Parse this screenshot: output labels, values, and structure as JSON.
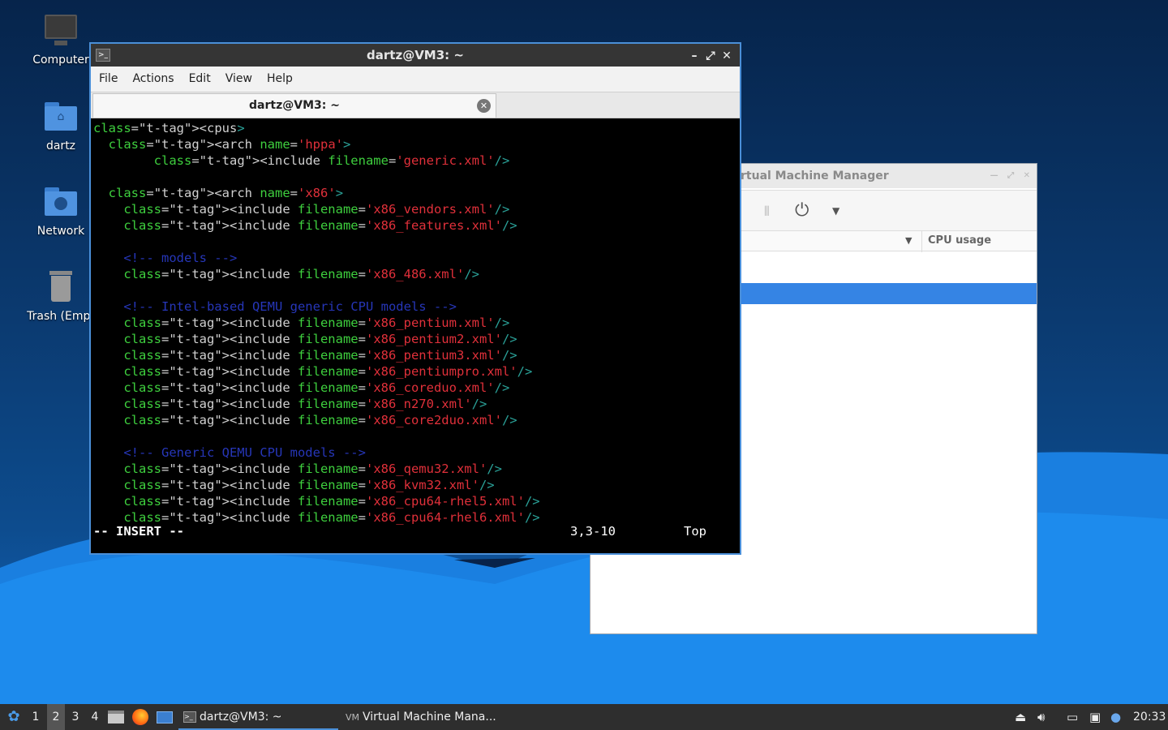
{
  "desktop": {
    "icons": [
      {
        "label": "Computer",
        "icon": "monitor-icon"
      },
      {
        "label": "dartz",
        "icon": "home-folder-icon"
      },
      {
        "label": "Network",
        "icon": "network-folder-icon"
      },
      {
        "label": "Trash (Empt",
        "icon": "trash-icon"
      }
    ]
  },
  "vmm": {
    "title": "rtual Machine Manager",
    "column_cpu": "CPU usage"
  },
  "terminal": {
    "title": "dartz@VM3: ~",
    "menu": [
      "File",
      "Actions",
      "Edit",
      "View",
      "Help"
    ],
    "tab_label": "dartz@VM3: ~",
    "status_mode": "-- INSERT --",
    "status_pos": "3,3-10",
    "status_scroll": "Top",
    "lines": [
      "<cpus>",
      "  <arch name='hppa'>",
      "        <include filename='generic.xml'/>",
      "",
      "  <arch name='x86'>",
      "    <include filename='x86_vendors.xml'/>",
      "    <include filename='x86_features.xml'/>",
      "",
      "    <!-- models -->",
      "    <include filename='x86_486.xml'/>",
      "",
      "    <!-- Intel-based QEMU generic CPU models -->",
      "    <include filename='x86_pentium.xml'/>",
      "    <include filename='x86_pentium2.xml'/>",
      "    <include filename='x86_pentium3.xml'/>",
      "    <include filename='x86_pentiumpro.xml'/>",
      "    <include filename='x86_coreduo.xml'/>",
      "    <include filename='x86_n270.xml'/>",
      "    <include filename='x86_core2duo.xml'/>",
      "",
      "    <!-- Generic QEMU CPU models -->",
      "    <include filename='x86_qemu32.xml'/>",
      "    <include filename='x86_kvm32.xml'/>",
      "    <include filename='x86_cpu64-rhel5.xml'/>",
      "    <include filename='x86_cpu64-rhel6.xml'/>"
    ]
  },
  "taskbar": {
    "workspaces": [
      "1",
      "2",
      "3",
      "4"
    ],
    "active_workspace": "2",
    "tasks": [
      "dartz@VM3: ~",
      "Virtual Machine Mana..."
    ],
    "clock": "20:33"
  },
  "colors": {
    "accent": "#4a8fd8",
    "selection": "#3584e4",
    "terminal_bg": "#000000"
  }
}
